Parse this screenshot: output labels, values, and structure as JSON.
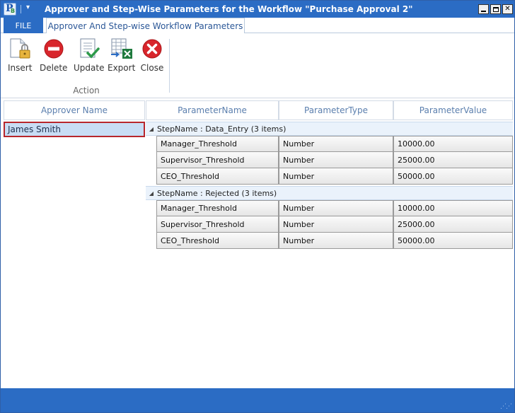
{
  "window": {
    "title": "Approver and Step-Wise Parameters for the Workflow \"Purchase Approval 2\"",
    "icon_name": "app-logo-icon"
  },
  "tabs": {
    "file_label": "FILE",
    "active_label": "Approver And Step-wise Workflow Parameters"
  },
  "ribbon": {
    "buttons": [
      {
        "label": "Insert",
        "icon": "insert-lock-icon"
      },
      {
        "label": "Delete",
        "icon": "delete-icon"
      },
      {
        "label": "Update",
        "icon": "update-icon"
      },
      {
        "label": "Export",
        "icon": "export-excel-icon"
      },
      {
        "label": "Close",
        "icon": "close-icon"
      }
    ],
    "group_label": "Action"
  },
  "approver_grid": {
    "header": "Approver Name",
    "rows": [
      "James Smith"
    ]
  },
  "param_grid": {
    "headers": [
      "ParameterName",
      "ParameterType",
      "ParameterValue"
    ],
    "groups": [
      {
        "label": "StepName : Data_Entry (3 items)",
        "rows": [
          [
            "Manager_Threshold",
            "Number",
            "10000.00"
          ],
          [
            "Supervisor_Threshold",
            "Number",
            "25000.00"
          ],
          [
            "CEO_Threshold",
            "Number",
            "50000.00"
          ]
        ]
      },
      {
        "label": "StepName : Rejected (3 items)",
        "rows": [
          [
            "Manager_Threshold",
            "Number",
            "10000.00"
          ],
          [
            "Supervisor_Threshold",
            "Number",
            "25000.00"
          ],
          [
            "CEO_Threshold",
            "Number",
            "50000.00"
          ]
        ]
      }
    ]
  },
  "colors": {
    "accent": "#2b6cc4",
    "selection": "#c8ddf4",
    "selection_border": "#b7262c"
  }
}
